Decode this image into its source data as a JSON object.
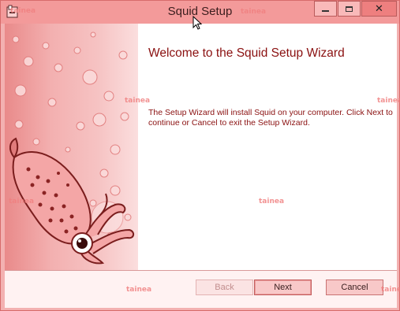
{
  "window": {
    "title": "Squid Setup",
    "caption_buttons": {
      "minimize_icon": "minimize-icon",
      "maximize_icon": "maximize-icon",
      "close_glyph": "✕"
    },
    "app_icon": "installer-icon"
  },
  "content": {
    "heading": "Welcome to the Squid Setup Wizard",
    "body": "The Setup Wizard will install Squid on your computer. Click Next to continue or Cancel to exit the Setup Wizard."
  },
  "buttons": {
    "back": "Back",
    "next": "Next",
    "cancel": "Cancel"
  },
  "watermark": "tainea",
  "colors": {
    "heading": "#8a1010",
    "tint": "#f7a1a1"
  }
}
